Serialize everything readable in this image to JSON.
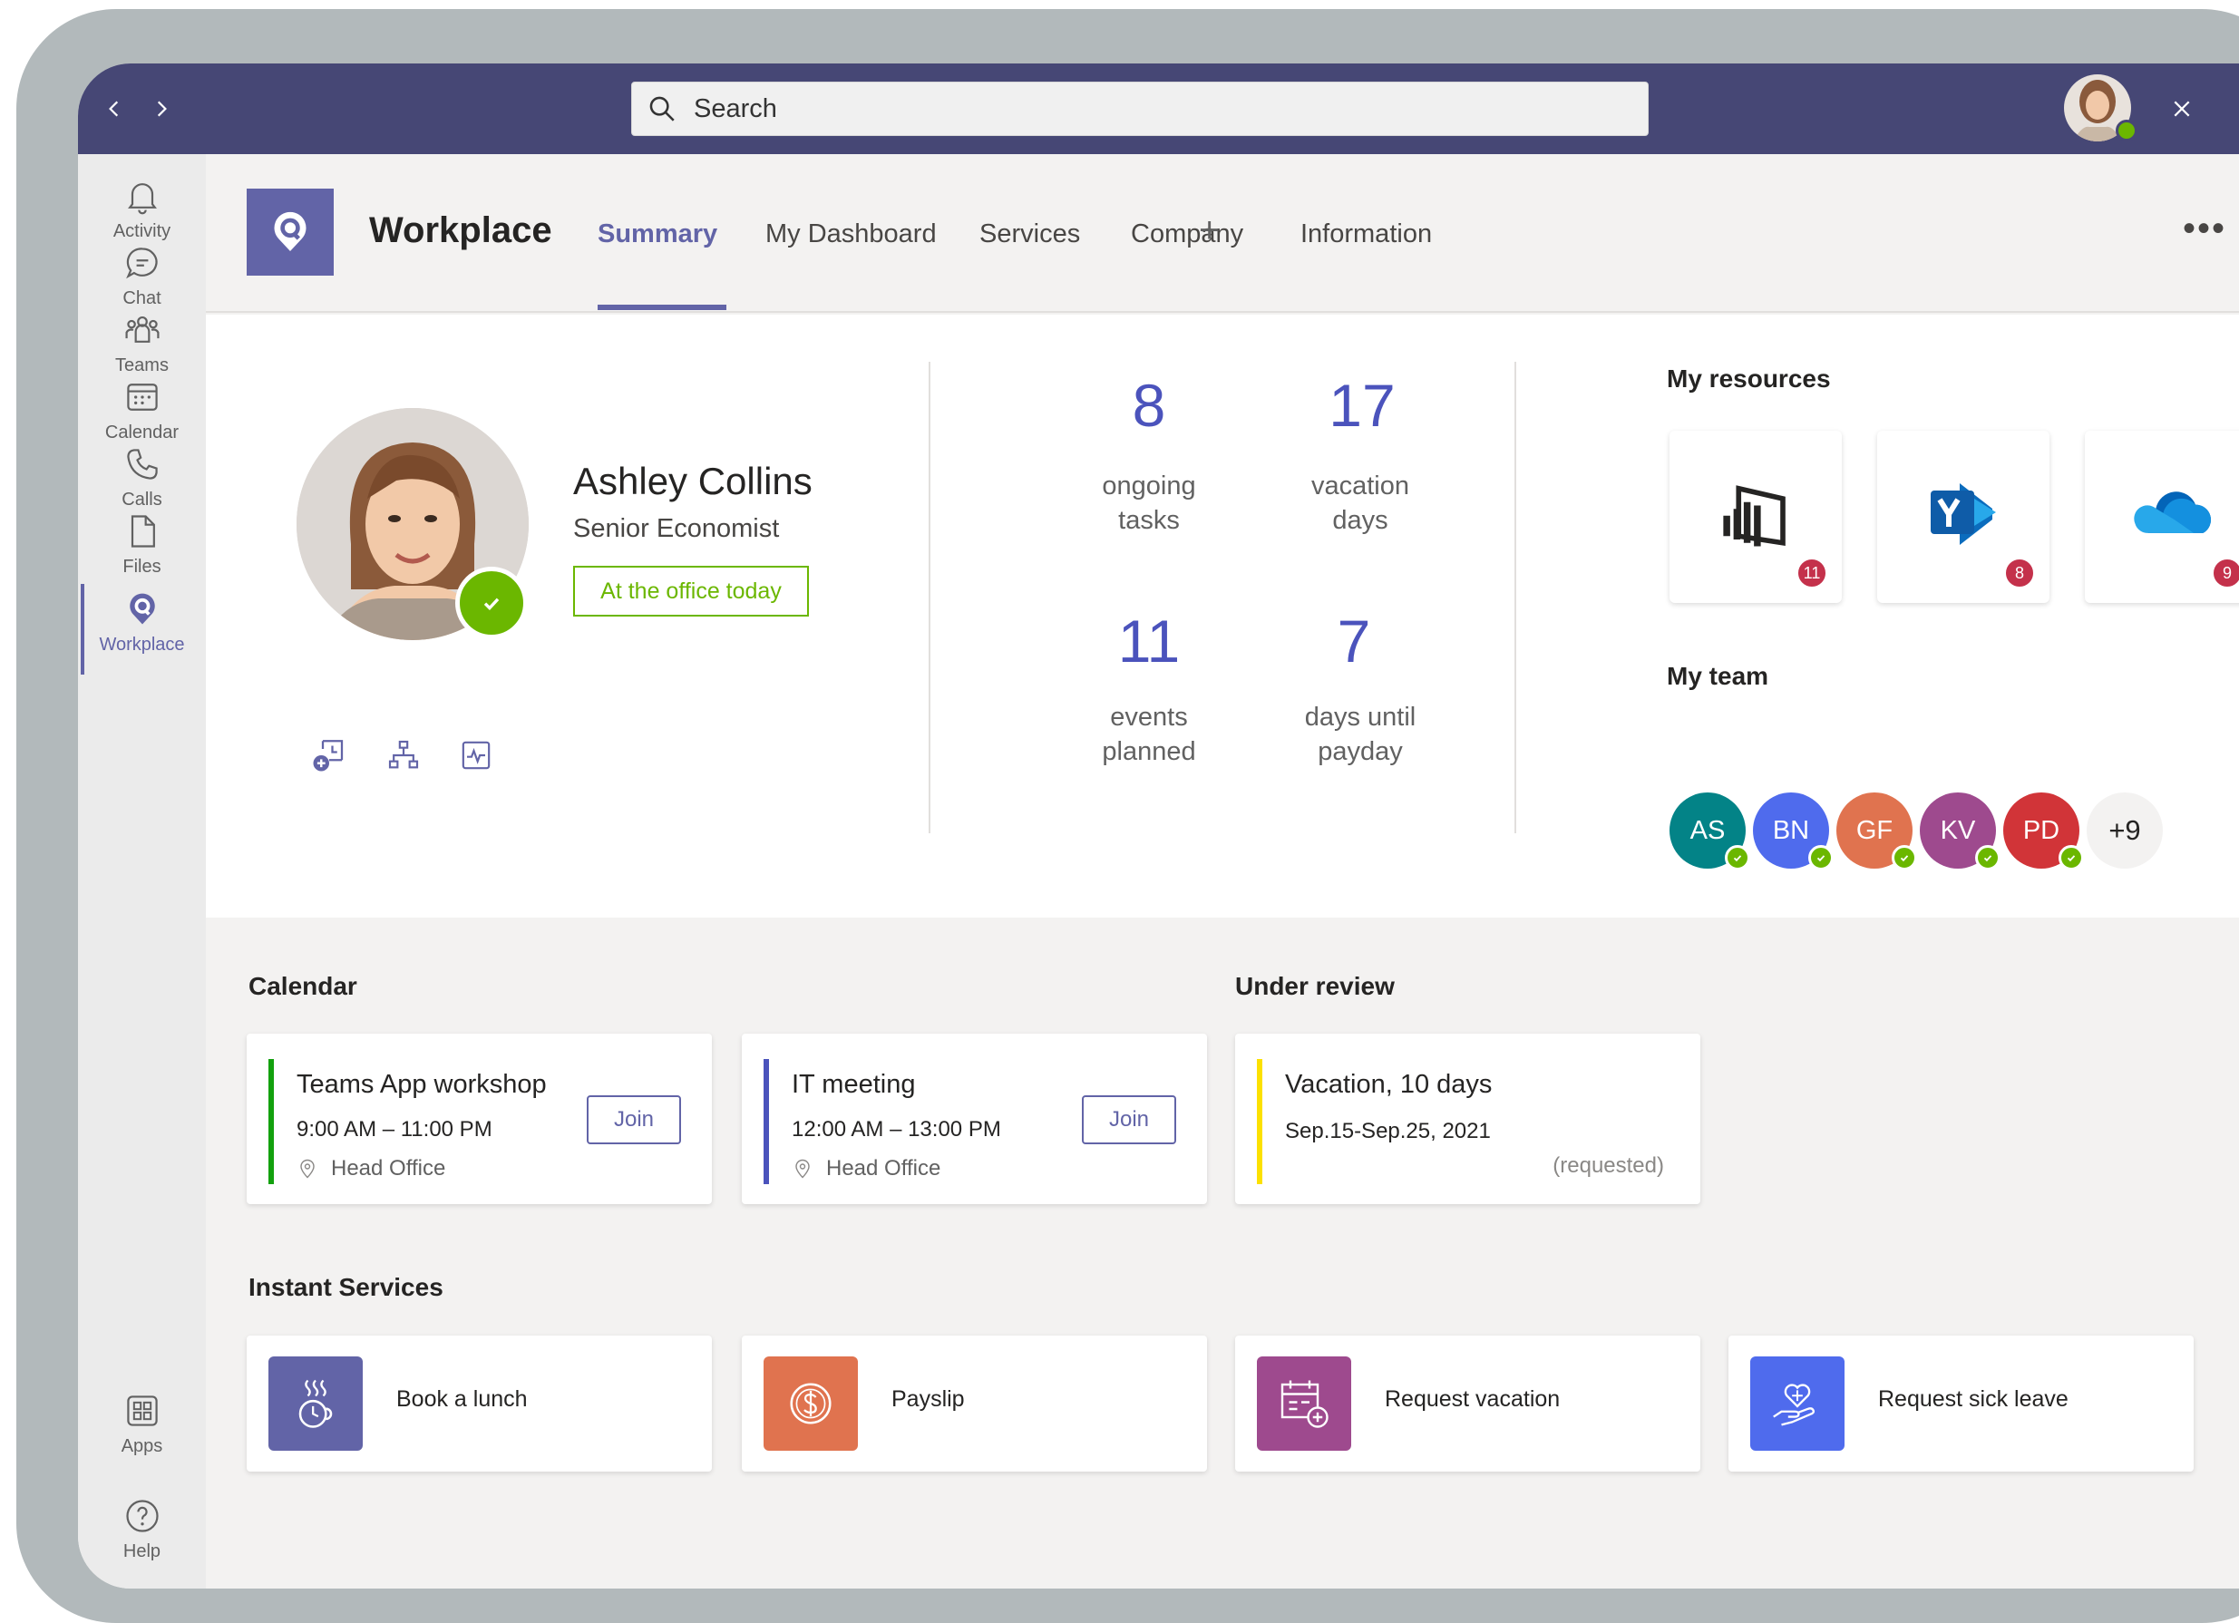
{
  "search": {
    "placeholder": "Search"
  },
  "rail": {
    "items": [
      {
        "label": "Activity",
        "icon": "bell-icon"
      },
      {
        "label": "Chat",
        "icon": "chat-icon"
      },
      {
        "label": "Teams",
        "icon": "teams-icon"
      },
      {
        "label": "Calendar",
        "icon": "calendar-icon"
      },
      {
        "label": "Calls",
        "icon": "phone-icon"
      },
      {
        "label": "Files",
        "icon": "file-icon"
      },
      {
        "label": "Workplace",
        "icon": "workplace-pin-icon",
        "active": true
      }
    ],
    "bottom": [
      {
        "label": "Apps",
        "icon": "apps-grid-icon"
      },
      {
        "label": "Help",
        "icon": "help-icon"
      }
    ]
  },
  "app": {
    "title": "Workplace",
    "tabs": [
      "Summary",
      "My Dashboard",
      "Services",
      "Company",
      "Information"
    ],
    "active_tab": "Summary",
    "add_tab": "+",
    "more": "•••"
  },
  "profile": {
    "name": "Ashley Collins",
    "title": "Senior Economist",
    "status": "At the office today"
  },
  "stats": [
    {
      "value": "8",
      "label_1": "ongoing",
      "label_2": "tasks"
    },
    {
      "value": "17",
      "label_1": "vacation",
      "label_2": "days"
    },
    {
      "value": "11",
      "label_1": "events",
      "label_2": "planned"
    },
    {
      "value": "7",
      "label_1": "days until",
      "label_2": "payday"
    }
  ],
  "resources": {
    "heading": "My resources",
    "items": [
      {
        "icon": "power-bi-icon",
        "badge": "11"
      },
      {
        "icon": "yammer-icon",
        "badge": "8"
      },
      {
        "icon": "onedrive-icon",
        "badge": "9"
      }
    ]
  },
  "team": {
    "heading": "My team",
    "members": [
      {
        "initials": "AS",
        "color": "#038387"
      },
      {
        "initials": "BN",
        "color": "#4f6bed"
      },
      {
        "initials": "GF",
        "color": "#e0734f"
      },
      {
        "initials": "KV",
        "color": "#9e4a8e"
      },
      {
        "initials": "PD",
        "color": "#d13438"
      }
    ],
    "more": "+9"
  },
  "calendar": {
    "heading": "Calendar",
    "events": [
      {
        "title": "Teams App workshop",
        "time": "9:00 AM – 11:00 PM",
        "location": "Head Office",
        "action": "Join",
        "color": "#13a10e"
      },
      {
        "title": "IT meeting",
        "time": "12:00 AM – 13:00 PM",
        "location": "Head Office",
        "action": "Join",
        "color": "#4b53bc"
      }
    ]
  },
  "review": {
    "heading": "Under review",
    "item": {
      "title": "Vacation, 10 days",
      "dates": "Sep.15-Sep.25, 2021",
      "status": "(requested)",
      "color": "#fce100"
    }
  },
  "services": {
    "heading": "Instant Services",
    "items": [
      {
        "label": "Book a lunch",
        "icon": "coffee-cup-icon",
        "color": "#6264a7"
      },
      {
        "label": "Payslip",
        "icon": "dollar-coin-icon",
        "color": "#e0734f"
      },
      {
        "label": "Request vacation",
        "icon": "calendar-add-icon",
        "color": "#9e4a8e"
      },
      {
        "label": "Request sick leave",
        "icon": "heart-hand-icon",
        "color": "#4f6bed"
      }
    ]
  }
}
